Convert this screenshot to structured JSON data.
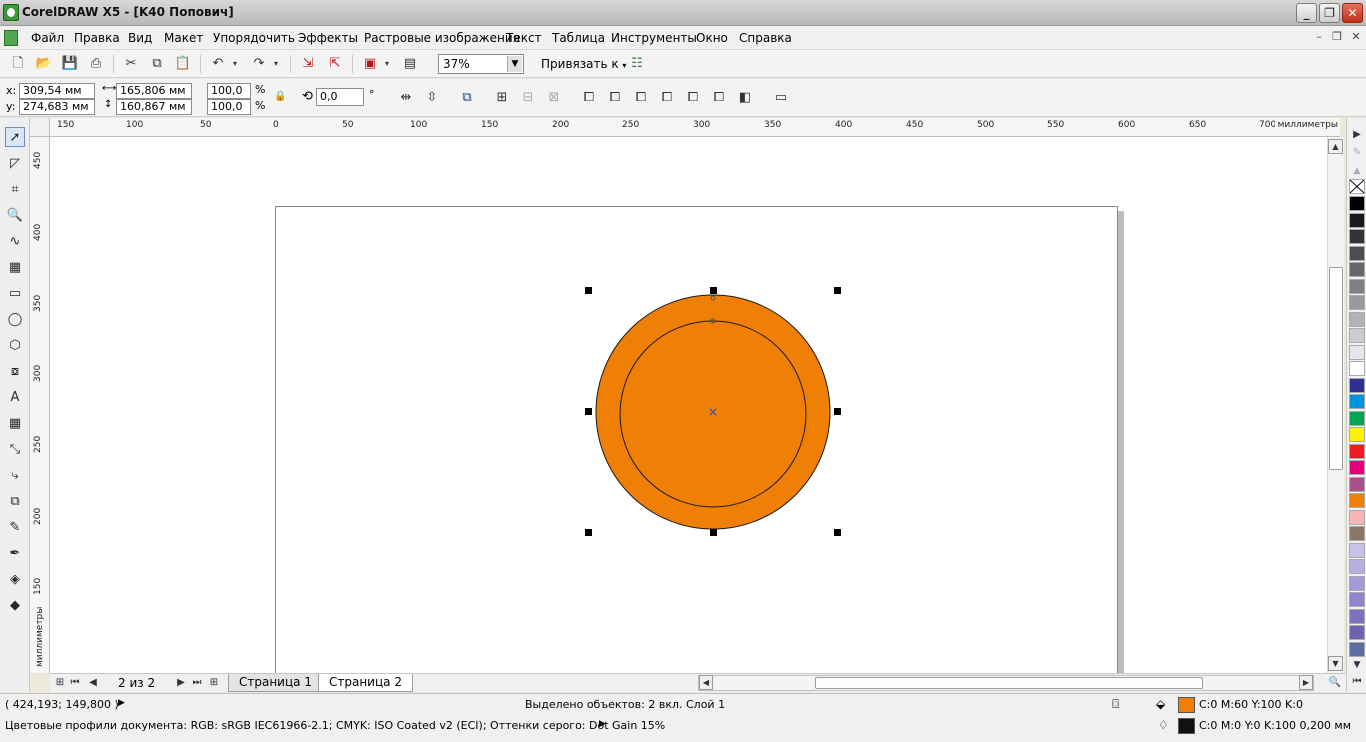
{
  "app": {
    "title": "CorelDRAW X5 - [K40 Попович]",
    "window_buttons": {
      "minimize": "_",
      "maximize": "❐",
      "close": "✕"
    }
  },
  "menu": {
    "items": [
      "Файл",
      "Правка",
      "Вид",
      "Макет",
      "Упорядочить",
      "Эффекты",
      "Растровые изображения",
      "Текст",
      "Таблица",
      "Инструменты",
      "Окно",
      "Справка"
    ],
    "mdi_buttons": [
      "–",
      "❐",
      "✕"
    ]
  },
  "toolbar": {
    "zoom_value": "37%",
    "snap_label": "Привязать к"
  },
  "property_bar": {
    "x_label": "x:",
    "x_value": "309,54 мм",
    "y_label": "y:",
    "y_value": "274,683 мм",
    "width_value": "165,806 мм",
    "height_value": "160,867 мм",
    "scale_x": "100,0",
    "scale_y": "100,0",
    "percent": "%",
    "rotation_value": "0,0",
    "degree": "°"
  },
  "ruler": {
    "unit": "миллиметры",
    "h_ticks": [
      "150",
      "100",
      "50",
      "0",
      "50",
      "100",
      "150",
      "200",
      "250",
      "300",
      "350",
      "400",
      "450",
      "500",
      "550",
      "600",
      "650",
      "700"
    ],
    "v_ticks": [
      "450",
      "400",
      "350",
      "300",
      "250",
      "200",
      "150"
    ]
  },
  "drawing": {
    "outer_circle_fill": "#f07f05",
    "stroke": "#1a1a1a",
    "selection_marker": "×"
  },
  "navigator": {
    "page_count": "2 из 2",
    "tabs": [
      "Страница 1",
      "Страница 2"
    ],
    "active_tab": "Страница 2"
  },
  "status": {
    "cursor_coords": "( 424,193; 149,800 )",
    "selection_info": "Выделено объектов: 2 вкл. Слой 1",
    "color_profiles": "Цветовые профили документа: RGB: sRGB IEC61966-2.1; CMYK: ISO Coated v2 (ECI); Оттенки серого: Dot Gain 15%",
    "fill_color": "#f07f05",
    "fill_text": "C:0 M:60 Y:100 K:0",
    "outline_color": "#111111",
    "outline_text": "C:0 M:0 Y:0 K:100  0,200 мм"
  },
  "palette": [
    "#000000",
    "#1a1a1a",
    "#333333",
    "#4d4d4d",
    "#666666",
    "#808080",
    "#999999",
    "#b3b3b3",
    "#cccccc",
    "#e6e6e6",
    "#ffffff",
    "#2e3192",
    "#0093dd",
    "#00a651",
    "#fff200",
    "#ed1c24",
    "#e4007c",
    "#a8518a",
    "#f07f05",
    "#f8b5b5",
    "#8b7765",
    "#c7c2e6",
    "#b8b0e0",
    "#a29bd8",
    "#8d86cc",
    "#7a72c0",
    "#6b63b0",
    "#5a6ea0"
  ]
}
